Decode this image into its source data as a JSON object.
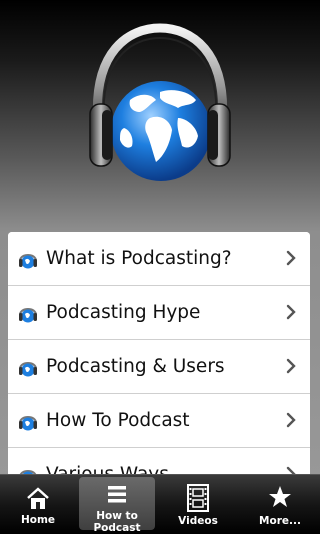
{
  "menu": {
    "items": [
      {
        "label": "What is Podcasting?"
      },
      {
        "label": "Podcasting Hype"
      },
      {
        "label": "Podcasting & Users"
      },
      {
        "label": "How To Podcast"
      },
      {
        "label": "Various Ways..."
      }
    ]
  },
  "tabbar": {
    "tabs": [
      {
        "label": "Home",
        "icon": "home-icon"
      },
      {
        "label": "How to Podcast",
        "icon": "list-icon",
        "active": true
      },
      {
        "label": "Videos",
        "icon": "film-icon"
      },
      {
        "label": "More...",
        "icon": "star-icon"
      }
    ]
  },
  "colors": {
    "globe_blue": "#1e7fe0",
    "row_bg": "#ffffff",
    "tab_bg": "#111111"
  }
}
